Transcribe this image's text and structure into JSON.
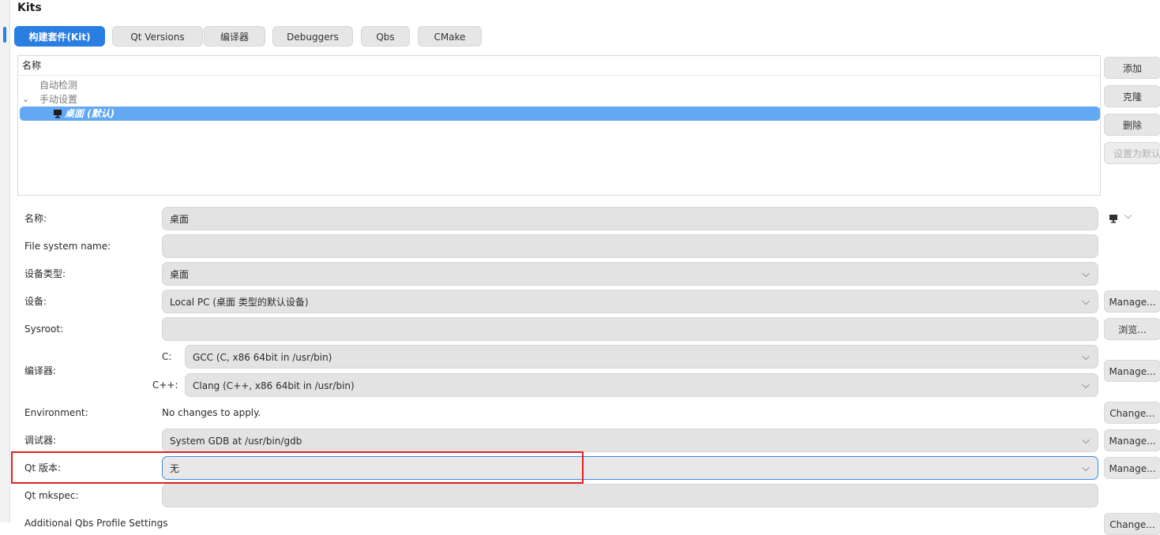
{
  "page": {
    "title": "Kits"
  },
  "tabs": [
    {
      "label": "构建套件(Kit)"
    },
    {
      "label": "Qt Versions"
    },
    {
      "label": "编译器"
    },
    {
      "label": "Debuggers"
    },
    {
      "label": "Qbs"
    },
    {
      "label": "CMake"
    }
  ],
  "tree": {
    "header": "名称",
    "auto": "自动检测",
    "manual": "手动设置",
    "manual_expander": "⌄",
    "selected_kit": "桌面 (默认)"
  },
  "side_buttons": {
    "add": "添加",
    "clone": "克隆",
    "remove": "删除",
    "make_default": "设置为默认"
  },
  "form": {
    "name_label": "名称:",
    "name_value": "桌面",
    "fs_label": "File system name:",
    "fs_value": "",
    "device_type_label": "设备类型:",
    "device_type_value": "桌面",
    "device_label": "设备:",
    "device_value": "Local PC (桌面 类型的默认设备)",
    "device_manage": "Manage...",
    "sysroot_label": "Sysroot:",
    "sysroot_value": "",
    "sysroot_browse": "浏览...",
    "compiler_label": "编译器:",
    "compiler_c_prefix": "C:",
    "compiler_c_value": "GCC (C, x86 64bit in /usr/bin)",
    "compiler_cxx_prefix": "C++:",
    "compiler_cxx_value": "Clang (C++, x86 64bit in /usr/bin)",
    "compiler_manage": "Manage...",
    "env_label": "Environment:",
    "env_value": "No changes to apply.",
    "env_change": "Change...",
    "debugger_label": "调试器:",
    "debugger_value": "System GDB at /usr/bin/gdb",
    "debugger_manage": "Manage...",
    "qt_label": "Qt 版本:",
    "qt_value": "无",
    "qt_manage": "Manage...",
    "mkspec_label": "Qt mkspec:",
    "mkspec_value": "",
    "qbs_label": "Additional Qbs Profile Settings",
    "qbs_change": "Change..."
  },
  "icons": {
    "chevron": "chevron-down-icon",
    "monitor": "monitor-icon",
    "chevron_char": "⌵"
  },
  "colors": {
    "accent": "#2a7de1",
    "selection": "#62a8f3",
    "highlight": "#e02020"
  }
}
